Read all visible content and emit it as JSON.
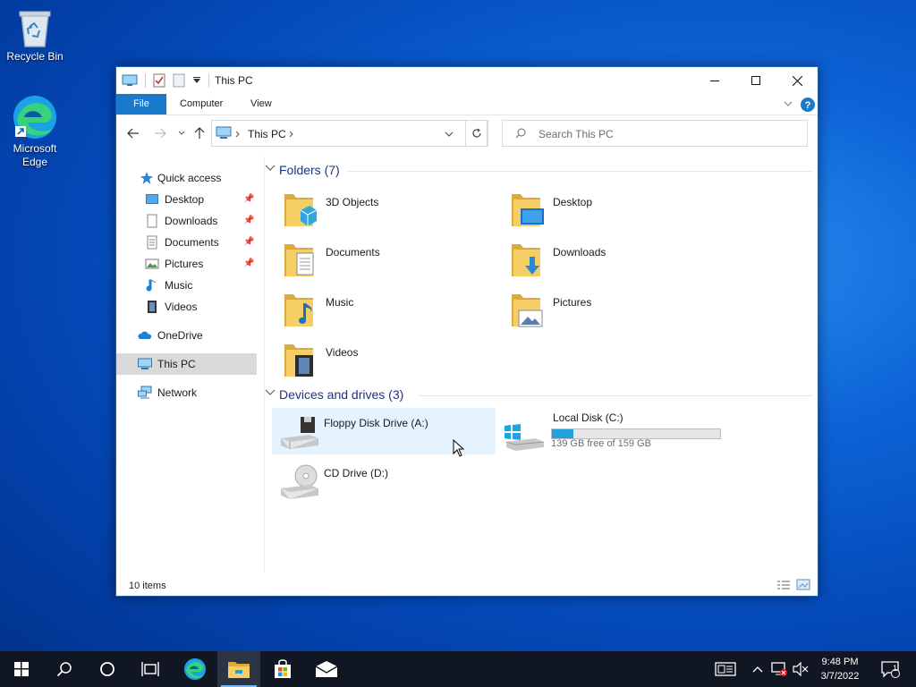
{
  "desktop": {
    "recycle_bin": "Recycle Bin",
    "edge_line1": "Microsoft",
    "edge_line2": "Edge"
  },
  "window": {
    "title": "This PC",
    "ribbon_tabs": [
      "File",
      "Computer",
      "View"
    ],
    "address": "This PC",
    "search_placeholder": "Search This PC"
  },
  "nav": {
    "quick_access": "Quick access",
    "quick_items": [
      {
        "label": "Desktop",
        "pinned": true
      },
      {
        "label": "Downloads",
        "pinned": true
      },
      {
        "label": "Documents",
        "pinned": true
      },
      {
        "label": "Pictures",
        "pinned": true
      },
      {
        "label": "Music",
        "pinned": false
      },
      {
        "label": "Videos",
        "pinned": false
      }
    ],
    "onedrive": "OneDrive",
    "this_pc": "This PC",
    "network": "Network"
  },
  "folders": {
    "header": "Folders (7)",
    "items": [
      "3D Objects",
      "Desktop",
      "Documents",
      "Downloads",
      "Music",
      "Pictures",
      "Videos"
    ]
  },
  "devices": {
    "header": "Devices and drives (3)",
    "floppy": "Floppy Disk Drive (A:)",
    "local_disk": "Local Disk (C:)",
    "local_disk_free": "139 GB free of 159 GB",
    "local_disk_used_fraction": 0.126,
    "cd_drive": "CD Drive (D:)"
  },
  "status": {
    "items": "10 items"
  },
  "taskbar": {
    "time": "9:48 PM",
    "date": "3/7/2022",
    "notification_count": "1"
  },
  "colors": {
    "accent": "#1979ca",
    "group_header": "#1e3287",
    "drive_fill": "#26a0da",
    "taskbar": "#101622"
  }
}
